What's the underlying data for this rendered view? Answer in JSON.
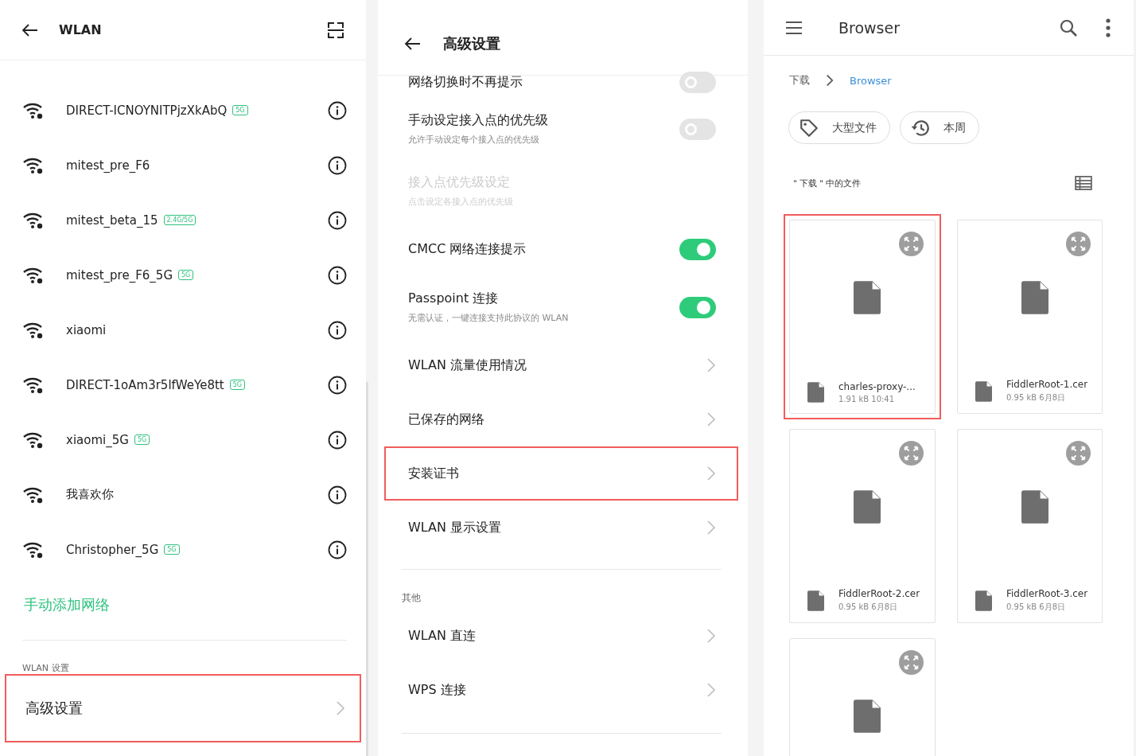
{
  "wlan_screen": {
    "title": "WLAN",
    "networks": [
      {
        "name": "DIRECT-ICNOYNITPjzXkAbQ",
        "band": "5G"
      },
      {
        "name": "mitest_pre_F6"
      },
      {
        "name": "mitest_beta_15",
        "band": "2.4G/5G"
      },
      {
        "name": "mitest_pre_F6_5G",
        "band": "5G"
      },
      {
        "name": "xiaomi"
      },
      {
        "name": "DIRECT-1oAm3r5lfWeYe8tt",
        "band": "5G"
      },
      {
        "name": "xiaomi_5G",
        "band": "5G"
      },
      {
        "name": "我喜欢你"
      },
      {
        "name": "Christopher_5G",
        "band": "5G"
      }
    ],
    "add_network": "手动添加网络",
    "section_label": "WLAN 设置",
    "settings": [
      {
        "label": "高级设置",
        "highlighted": true
      }
    ]
  },
  "advanced_screen": {
    "title": "高级设置",
    "items": [
      {
        "kind": "toggle",
        "label": "网络切换时不再提示",
        "on": false,
        "disabled": false,
        "highlighted": false
      },
      {
        "kind": "toggle",
        "label": "手动设定接入点的优先级",
        "subtitle": "允许手动设定每个接入点的优先级",
        "on": false,
        "disabled": false,
        "highlighted": false
      },
      {
        "kind": "text",
        "label": "接入点优先级设定",
        "subtitle": "点击设定各接入点的优先级",
        "disabled": true,
        "highlighted": false
      },
      {
        "kind": "toggle",
        "label": "CMCC 网络连接提示",
        "on": true,
        "disabled": false,
        "highlighted": false
      },
      {
        "kind": "toggle",
        "label": "Passpoint 连接",
        "subtitle": "无需认证，一键连接支持此协议的 WLAN",
        "on": true,
        "disabled": false,
        "highlighted": false
      },
      {
        "kind": "link",
        "label": "WLAN 流量使用情况",
        "disabled": false,
        "highlighted": false
      },
      {
        "kind": "link",
        "label": "已保存的网络",
        "disabled": false,
        "highlighted": false
      },
      {
        "kind": "link",
        "label": "安装证书",
        "disabled": false,
        "highlighted": true
      },
      {
        "kind": "link",
        "label": "WLAN 显示设置",
        "disabled": false,
        "highlighted": false
      },
      {
        "kind": "header",
        "label": "其他"
      },
      {
        "kind": "link",
        "label": "WLAN 直连",
        "disabled": false,
        "highlighted": false
      },
      {
        "kind": "link",
        "label": "WPS 连接",
        "disabled": false,
        "highlighted": false
      }
    ]
  },
  "browser_screen": {
    "title": "Browser",
    "breadcrumb": [
      {
        "label": "下载",
        "current": false
      },
      {
        "label": "Browser",
        "current": true
      }
    ],
    "chips": [
      {
        "kind": "tag",
        "label": "大型文件"
      },
      {
        "kind": "history",
        "label": "本周"
      }
    ],
    "section_title": "＂下载＂中的文件",
    "files": [
      {
        "name": "charles-proxy-...",
        "meta": "1.91 kB 10:41",
        "highlighted": true
      },
      {
        "name": "FiddlerRoot-1.cer",
        "meta": "0.95 kB 6月8日",
        "highlighted": false
      },
      {
        "name": "FiddlerRoot-2.cer",
        "meta": "0.95 kB 6月8日",
        "highlighted": false
      },
      {
        "name": "FiddlerRoot-3.cer",
        "meta": "0.95 kB 6月8日",
        "highlighted": false
      },
      {
        "highlighted": false
      }
    ]
  }
}
